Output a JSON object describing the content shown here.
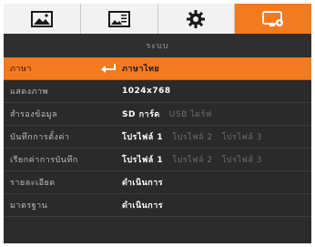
{
  "tabs": [
    {
      "icon": "picture-icon"
    },
    {
      "icon": "image-settings-icon"
    },
    {
      "icon": "gear-icon"
    },
    {
      "icon": "display-settings-icon"
    }
  ],
  "menu": {
    "title": "ระบบ",
    "rows": [
      {
        "label": "ภาษา",
        "value": "ภาษาไทย",
        "options": []
      },
      {
        "label": "แสดงภาพ",
        "value": "1024x768",
        "options": []
      },
      {
        "label": "สำรองข้อมูล",
        "value": "SD การ์ด",
        "options": [
          "USB ไดร์ฟ"
        ]
      },
      {
        "label": "บันทึกการตั้งค่า",
        "value": "โปรไฟล์ 1",
        "options": [
          "โปรไฟล์ 2",
          "โปรไฟล์ 3"
        ]
      },
      {
        "label": "เรียกค่าการบันทึก",
        "value": "โปรไฟล์ 1",
        "options": [
          "โปรไฟล์ 2",
          "โปรไฟล์ 3"
        ]
      },
      {
        "label": "รายละเอียด",
        "value": "ดำเนินการ",
        "options": []
      },
      {
        "label": "มาตรฐาน",
        "value": "ดำเนินการ",
        "options": []
      }
    ]
  },
  "colors": {
    "accent": "#f47a20",
    "background": "#2b2b2b"
  }
}
